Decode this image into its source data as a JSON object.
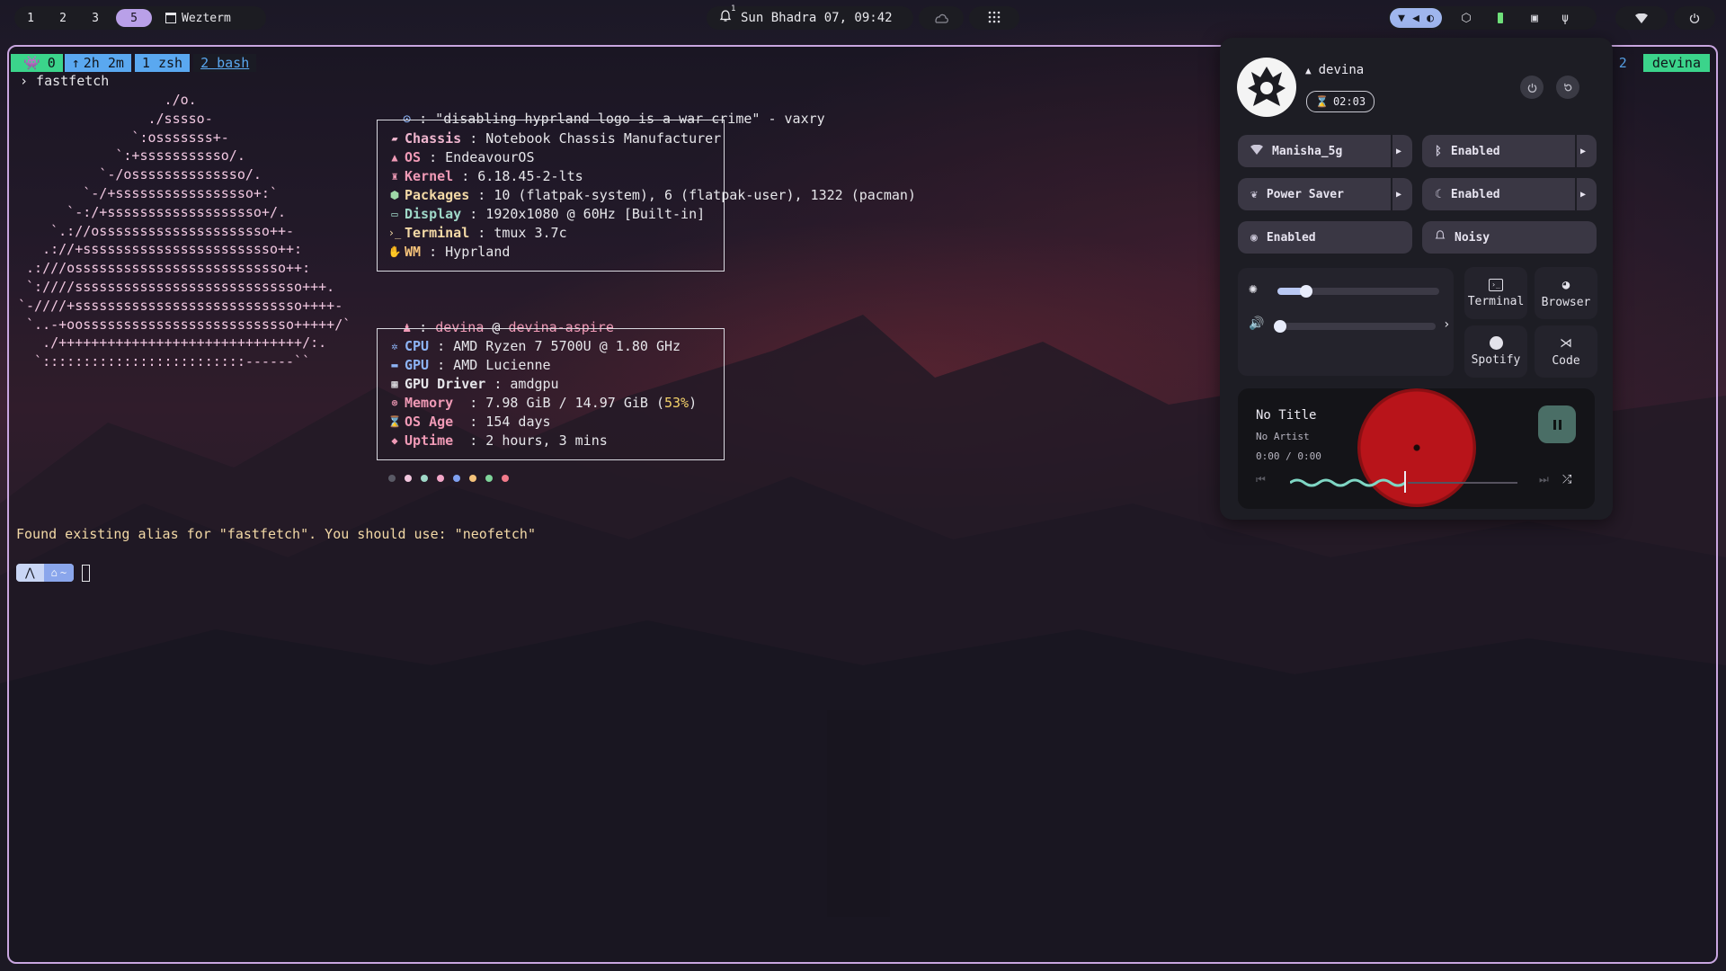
{
  "topbar": {
    "workspaces": [
      "1",
      "2",
      "3",
      "5"
    ],
    "active_workspace": "5",
    "window_title": "Wezterm",
    "notification_count": "1",
    "datetime": "Sun Bhadra 07, 09:42"
  },
  "tmux": {
    "segments": [
      "0",
      "2h 2m",
      "1 zsh",
      "2 bash"
    ],
    "right_index": "2",
    "right_user": "devina"
  },
  "terminal": {
    "prompt_command": "› fastfetch",
    "logo_lines": [
      "                  ./o.",
      "                ./sssso-",
      "              `:osssssss+-",
      "            `:+sssssssssso/.",
      "          `-/ossssssssssssso/.",
      "        `-/+sssssssssssssssso+:`",
      "      `-:/+sssssssssssssssssso+/.",
      "    `.://osssssssssssssssssssso++-",
      "   .://+ssssssssssssssssssssssso++:",
      " .:///ossssssssssssssssssssssssso++:",
      " `:////ssssssssssssssssssssssssssso+++.",
      "`-////+ssssssssssssssssssssssssssso++++-",
      " `..-+oossssssssssssssssssssssssso+++++/`",
      "   ./++++++++++++++++++++++++++++++/:.",
      "  `:::::::::::::::::::::::::------``"
    ],
    "quote": ": \"disabling hyprland logo is a war crime\" - vaxry",
    "system_info": [
      {
        "key": "Chassis",
        "value": " : Notebook Chassis Manufacturer",
        "icon": "chassis-icon"
      },
      {
        "key": "OS",
        "value": " : EndeavourOS",
        "icon": "os-icon"
      },
      {
        "key": "Kernel",
        "value": " : 6.18.45-2-lts",
        "icon": "kernel-icon"
      },
      {
        "key": "Packages",
        "value": " : 10 (flatpak-system), 6 (flatpak-user), 1322 (pacman)",
        "icon": "packages-icon"
      },
      {
        "key": "Display",
        "value": " : 1920x1080 @ 60Hz [Built-in]",
        "icon": "display-icon"
      },
      {
        "key": "Terminal",
        "value": " : tmux 3.7c",
        "icon": "terminal-icon"
      },
      {
        "key": "WM",
        "value": " : Hyprland",
        "icon": "wm-icon"
      }
    ],
    "user_host": {
      "user": "devina",
      "at": " @ ",
      "host": "devina-aspire",
      "prefix": ": "
    },
    "hardware_info": [
      {
        "key": "CPU",
        "value": " : AMD Ryzen 7 5700U @ 1.80 GHz",
        "icon": "cpu-icon"
      },
      {
        "key": "GPU",
        "value": " : AMD Lucienne",
        "icon": "gpu-icon"
      },
      {
        "key": "GPU Driver",
        "value": " : amdgpu",
        "icon": "gpu-driver-icon"
      },
      {
        "key": "Memory",
        "value": "  : 7.98 GiB / 14.97 GiB (",
        "value_pct": "53%",
        "value_end": ")",
        "icon": "memory-icon"
      },
      {
        "key": "OS Age",
        "value": "  : 154 days",
        "icon": "os-age-icon"
      },
      {
        "key": "Uptime",
        "value": "  : 2 hours, 3 mins",
        "icon": "uptime-icon"
      }
    ],
    "palette": [
      "#5a5a66",
      "#f2c6de",
      "#9fd8c8",
      "#f3a6c8",
      "#7fa0f0",
      "#f5c27a",
      "#7fd49a",
      "#f27a8a"
    ],
    "alias_message": "Found existing alias for \"fastfetch\". You should use: \"neofetch\"",
    "prompt_home": "~"
  },
  "panel": {
    "username": "devina",
    "uptime": "02:03",
    "toggles": [
      {
        "label": "Manisha_5g",
        "icon": "wifi-icon",
        "has_arrow": true
      },
      {
        "label": "Enabled",
        "icon": "bluetooth-icon",
        "has_arrow": true
      },
      {
        "label": "Power Saver",
        "icon": "leaf-icon",
        "has_arrow": true
      },
      {
        "label": "Enabled",
        "icon": "night-light-icon",
        "has_arrow": true
      },
      {
        "label": "Enabled",
        "icon": "eye-icon",
        "has_arrow": false
      },
      {
        "label": "Noisy",
        "icon": "bell-icon",
        "has_arrow": false
      }
    ],
    "brightness_level": 0.16,
    "volume_level": 0.0,
    "apps": [
      {
        "label": "Terminal",
        "icon": "terminal-app-icon"
      },
      {
        "label": "Browser",
        "icon": "browser-icon"
      },
      {
        "label": "Spotify",
        "icon": "spotify-icon"
      },
      {
        "label": "Code",
        "icon": "vscode-icon"
      }
    ],
    "media": {
      "title": "No Title",
      "artist": "No Artist",
      "time": "0:00 / 0:00"
    }
  },
  "colors": {
    "accent_lavender": "#b9a0e8",
    "tmux_green": "#3bd48b",
    "tmux_blue": "#5aa8f0",
    "vinyl_red": "#b8141a",
    "wave_teal": "#7fd6c4"
  }
}
